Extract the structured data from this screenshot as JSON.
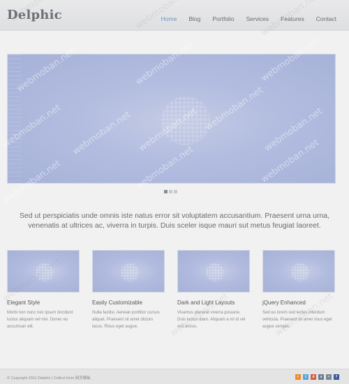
{
  "header": {
    "logo": "Delphic",
    "nav": [
      {
        "label": "Home",
        "active": true
      },
      {
        "label": "Blog",
        "active": false
      },
      {
        "label": "Portfolio",
        "active": false
      },
      {
        "label": "Services",
        "active": false
      },
      {
        "label": "Features",
        "active": false
      },
      {
        "label": "Contact",
        "active": false
      }
    ]
  },
  "slider": {
    "slide_count": 3,
    "active_index": 0
  },
  "intro": {
    "text": "Sed ut perspiciatis unde omnis iste natus error sit voluptatem accusantium. Praesent urna urna, venenatis at ultrices ac, viverra in turpis. Duis sceler isque mauri sut metus feugiat laoreet."
  },
  "features": [
    {
      "title": "Elegant Style",
      "text": "Morbi non nunc nec ipsum tincidunt luctus aliquam vel nisi. Donec eu accumsan elit."
    },
    {
      "title": "Easily Customizable",
      "text": "Nulla facilisi. Aenean porttitor cursus aliquet. Praesent sit amet dictum lacus. Risus eget augue."
    },
    {
      "title": "Dark and Light Layouts",
      "text": "Vivamus placerat viverra posuere. Duis luctus diam. Aliquam a mi id vel orci lectus."
    },
    {
      "title": "jQuery Enhanced",
      "text": "Sed eu lorem sed lectus interdum vehicula. Praesent sit amet risus eget augue semper."
    }
  ],
  "footer": {
    "copyright": "© Copyright 2011 Delphic | Collect from 网页模板",
    "social": [
      {
        "icon": "rss-icon",
        "glyph": "r",
        "color": "#f08a24"
      },
      {
        "icon": "twitter-icon",
        "glyph": "t",
        "color": "#5aa7d6"
      },
      {
        "icon": "digg-icon",
        "glyph": "d",
        "color": "#d25b3e"
      },
      {
        "icon": "stumbleupon-icon",
        "glyph": "s",
        "color": "#6b7b8c"
      },
      {
        "icon": "flickr-icon",
        "glyph": "•",
        "color": "#7c8796"
      },
      {
        "icon": "facebook-icon",
        "glyph": "f",
        "color": "#3b5998"
      }
    ]
  },
  "watermark": "webmoban.net"
}
